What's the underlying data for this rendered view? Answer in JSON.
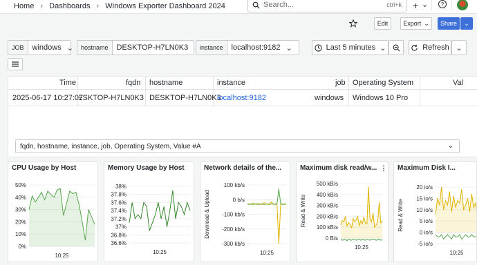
{
  "breadcrumb": {
    "home": "Home",
    "sep1": "›",
    "dashboards": "Dashboards",
    "sep2": "›",
    "current": "Windows Exporter Dashboard 2024"
  },
  "search": {
    "placeholder": "Search...",
    "shortcut": "ctrl+k"
  },
  "topicons": {
    "plus": "+",
    "plus_chevron": "⌄",
    "help": "?"
  },
  "toolbar": {
    "edit": "Edit",
    "export": "Export",
    "share": "Share"
  },
  "variables": [
    {
      "label": "JOB",
      "value": "windows"
    },
    {
      "label": "hostname",
      "value": "DESKTOP-H7LN0K3"
    },
    {
      "label": "instance",
      "value": "localhost:9182"
    }
  ],
  "timepicker": {
    "range": "Last 5 minutes",
    "refresh": "Refresh"
  },
  "table": {
    "headers": [
      "Time",
      "fqdn",
      "hostname",
      "instance",
      "job",
      "Operating System",
      "Val"
    ],
    "row": [
      "2025-06-17 10:27:07",
      "DESKTOP-H7LN0K3",
      "DESKTOP-H7LN0K3",
      "localhost:9182",
      "windows",
      "Windows 10 Pro",
      ""
    ],
    "field_select": "fqdn, hostname, instance, job, Operating System, Value #A"
  },
  "panels": [
    {
      "title": "CPU Usage by Host",
      "yticks": [
        "50%",
        "40%",
        "30%",
        "20%",
        "10%",
        "0%"
      ],
      "xtick": "10:25",
      "ylabel": "",
      "color": "#56a64b"
    },
    {
      "title": "Memory Usage by Host",
      "yticks": [
        "38%",
        "37.8%",
        "37.6%",
        "37.4%",
        "37.2%",
        "37%",
        "36.8%",
        "36.6%"
      ],
      "xtick": "10:25",
      "ylabel": "",
      "color": "#37872d"
    },
    {
      "title": "Network details of the...",
      "yticks": [
        "100 kb/s",
        "0 b/s",
        "-100 kb/s",
        "-200 kb/s",
        "-300 kb/s"
      ],
      "xtick": "10:25",
      "ylabel": "Download & Upload",
      "color": "#e0b400"
    },
    {
      "title": "Maximum disk read/w...",
      "yticks": [
        "500 kB/s",
        "400 kB/s",
        "300 kB/s",
        "200 kB/s",
        "100 kB/s",
        "0 B/s"
      ],
      "xtick": "10:25",
      "ylabel": "Read & Write",
      "color": "#e0b400"
    },
    {
      "title": "Maximum Disk I...",
      "yticks": [
        "20 io/s",
        "15 io/s",
        "10 io/s",
        "5 io/s",
        "0 io/s",
        "-5 io/s"
      ],
      "xtick": "10:25",
      "ylabel": "Read & Write",
      "color": "#e0b400"
    }
  ],
  "chart_data": [
    {
      "type": "area",
      "title": "CPU Usage by Host",
      "ylim": [
        0,
        50
      ],
      "series": [
        {
          "values": [
            30,
            41,
            36,
            40,
            44,
            38,
            45,
            42,
            40,
            46,
            47,
            25,
            35,
            45,
            43,
            44,
            34,
            20,
            5,
            30,
            24,
            18
          ]
        }
      ]
    },
    {
      "type": "line",
      "title": "Memory Usage by Host",
      "ylim": [
        36.6,
        38.0
      ],
      "series": [
        {
          "values": [
            37.1,
            37.6,
            37.2,
            37.3,
            37.2,
            37.6,
            37.5,
            36.9,
            37.1,
            37.3,
            37.6,
            37.2,
            37.5,
            37.0,
            37.4,
            37.9,
            37.2,
            37.6,
            37.5,
            37.3,
            37.6,
            37.4
          ]
        }
      ]
    },
    {
      "type": "line",
      "title": "Network details of the...",
      "ylim": [
        -300,
        150
      ],
      "series": [
        {
          "values": [
            0,
            5,
            0,
            10,
            5,
            0,
            8,
            2,
            0,
            15,
            5,
            0,
            5,
            20,
            0,
            5,
            0,
            -300,
            0,
            5,
            0,
            5
          ]
        },
        {
          "values": [
            5,
            0,
            5,
            0,
            3,
            5,
            0,
            4,
            5,
            0,
            3,
            5,
            0,
            5,
            4,
            0,
            5,
            120,
            5,
            0,
            4,
            0
          ]
        }
      ]
    },
    {
      "type": "area",
      "title": "Maximum disk read/w...",
      "ylim": [
        0,
        500
      ],
      "series": [
        {
          "values": [
            120,
            160,
            150,
            200,
            110,
            140,
            130,
            90,
            180,
            150,
            170,
            200,
            110,
            160,
            130,
            190,
            140,
            130,
            470,
            180,
            150,
            230,
            100,
            120,
            150,
            330,
            140,
            160
          ]
        },
        {
          "values": [
            -10,
            -20,
            -15,
            -10,
            -25,
            -10,
            -15,
            -20,
            -10,
            -10,
            -20,
            -15,
            -10,
            -20,
            -10,
            -15,
            -20,
            -10,
            -15,
            -20,
            -10,
            -15,
            -10,
            -20,
            -15,
            -10,
            -20,
            -15
          ]
        }
      ]
    },
    {
      "type": "area",
      "title": "Maximum Disk I...",
      "ylim": [
        -5,
        20
      ],
      "series": [
        {
          "values": [
            8,
            15,
            12,
            20,
            10,
            14,
            12,
            18,
            9,
            16,
            11,
            14,
            13,
            19,
            10,
            12,
            15,
            9,
            17,
            11,
            13,
            5
          ]
        },
        {
          "values": [
            -1,
            -2,
            -2,
            -1,
            -3,
            -2,
            -1,
            -2,
            -3,
            -1,
            -2,
            -2,
            -1,
            -3,
            -2,
            -1,
            -2,
            -2,
            -1,
            -2,
            -2,
            -1
          ]
        }
      ]
    }
  ]
}
